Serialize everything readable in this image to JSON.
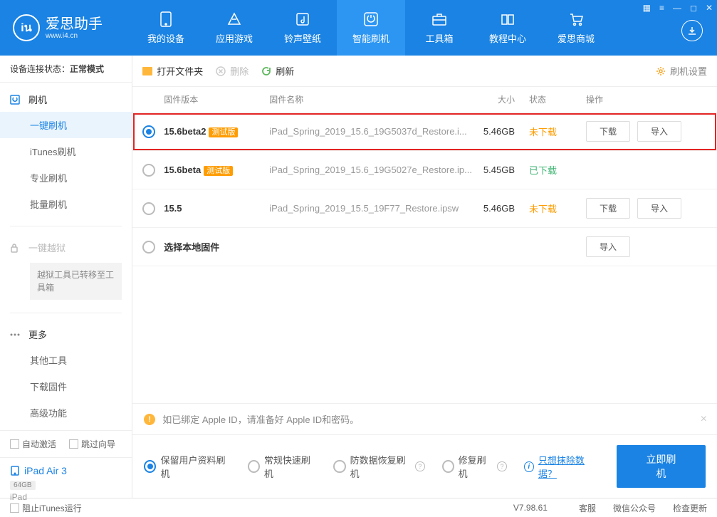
{
  "window_controls": [
    "▦",
    "≡",
    "—",
    "◻",
    "✕"
  ],
  "logo": {
    "title": "爱思助手",
    "subtitle": "www.i4.cn",
    "mark": "iน"
  },
  "nav": [
    {
      "label": "我的设备"
    },
    {
      "label": "应用游戏"
    },
    {
      "label": "铃声壁纸"
    },
    {
      "label": "智能刷机"
    },
    {
      "label": "工具箱"
    },
    {
      "label": "教程中心"
    },
    {
      "label": "爱思商城"
    }
  ],
  "sidebar": {
    "status_label": "设备连接状态：",
    "status_value": "正常模式",
    "flash_head": "刷机",
    "flash_items": [
      "一键刷机",
      "iTunes刷机",
      "专业刷机",
      "批量刷机"
    ],
    "jailbreak_head": "一键越狱",
    "jailbreak_note": "越狱工具已转移至工具箱",
    "more_head": "更多",
    "more_items": [
      "其他工具",
      "下载固件",
      "高级功能"
    ],
    "auto_activate": "自动激活",
    "skip_guide": "跳过向导",
    "device_name": "iPad Air 3",
    "device_storage": "64GB",
    "device_type": "iPad"
  },
  "toolbar": {
    "open_folder": "打开文件夹",
    "delete": "删除",
    "refresh": "刷新",
    "settings": "刷机设置"
  },
  "columns": {
    "version": "固件版本",
    "name": "固件名称",
    "size": "大小",
    "status": "状态",
    "actions": "操作"
  },
  "rows": [
    {
      "version": "15.6beta2",
      "beta": "测试版",
      "name": "iPad_Spring_2019_15.6_19G5037d_Restore.i...",
      "size": "5.46GB",
      "status": "未下载",
      "status_class": "orange",
      "download": "下载",
      "import": "导入",
      "selected": true,
      "has_buttons": true,
      "highlight": true
    },
    {
      "version": "15.6beta",
      "beta": "测试版",
      "name": "iPad_Spring_2019_15.6_19G5027e_Restore.ip...",
      "size": "5.45GB",
      "status": "已下载",
      "status_class": "green",
      "has_buttons": false
    },
    {
      "version": "15.5",
      "beta": "",
      "name": "iPad_Spring_2019_15.5_19F77_Restore.ipsw",
      "size": "5.46GB",
      "status": "未下载",
      "status_class": "orange",
      "download": "下载",
      "import": "导入",
      "has_buttons": true
    },
    {
      "version": "选择本地固件",
      "beta": "",
      "name": "",
      "size": "",
      "status": "",
      "import": "导入",
      "local": true
    }
  ],
  "alert": "如已绑定 Apple ID，请准备好 Apple ID和密码。",
  "options": [
    "保留用户资料刷机",
    "常规快速刷机",
    "防数据恢复刷机",
    "修复刷机"
  ],
  "erase_link": "只想抹除数据？",
  "flash_now": "立即刷机",
  "footer": {
    "stop_itunes": "阻止iTunes运行",
    "version": "V7.98.61",
    "support": "客服",
    "wechat": "微信公众号",
    "update": "检查更新"
  }
}
